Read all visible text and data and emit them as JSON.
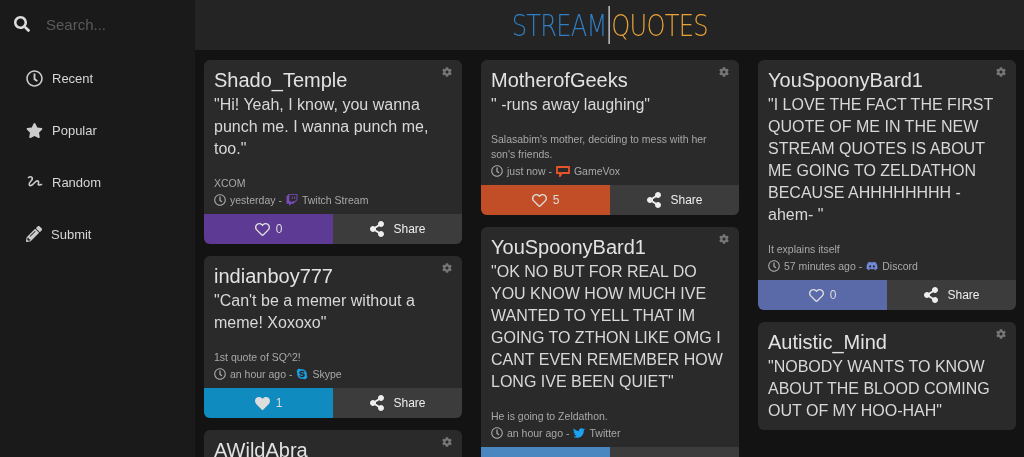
{
  "sidebar": {
    "search": {
      "placeholder": "Search..."
    },
    "items": [
      {
        "label": "Recent"
      },
      {
        "label": "Popular"
      },
      {
        "label": "Random"
      },
      {
        "label": "Submit"
      }
    ]
  },
  "header": {
    "logo": {
      "left": "STREAM",
      "right": "QUOTES"
    }
  },
  "columns": [
    {
      "cards": [
        {
          "user": "Shado_Temple",
          "quote": "\"Hi! Yeah, I know, you wanna punch me. I wanna punch me, too.\"",
          "note": "XCOM",
          "time": "yesterday -",
          "source": {
            "kind": "twitch",
            "label": "Twitch Stream"
          },
          "footer": {
            "color": "#5d3a93",
            "liked": false,
            "count": "0",
            "share": "Share"
          }
        },
        {
          "user": "indianboy777",
          "quote": "\"Can't be a memer without a meme! Xoxoxo\"",
          "note": "1st quote of SQ^2!",
          "time": "an hour ago -",
          "source": {
            "kind": "skype",
            "label": "Skype"
          },
          "footer": {
            "color": "#0f8bc0",
            "liked": true,
            "count": "1",
            "share": "Share"
          }
        },
        {
          "user": "AWildAbra"
        }
      ]
    },
    {
      "cards": [
        {
          "user": "MotherofGeeks",
          "quote": "\" -runs away laughing\"",
          "note": "Salasabim's mother, deciding to mess with her son's friends.",
          "time": "just now -",
          "source": {
            "kind": "gamevox",
            "label": "GameVox"
          },
          "footer": {
            "color": "#c14e26",
            "liked": false,
            "count": "5",
            "share": "Share"
          }
        },
        {
          "user": "YouSpoonyBard1",
          "quote": "\"OK NO BUT FOR REAL DO YOU KNOW HOW MUCH IVE WANTED TO YELL THAT IM GOING TO ZTHON LIKE OMG I CANT EVEN REMEMBER HOW LONG IVE BEEN QUIET\"",
          "note": "He is going to Zeldathon.",
          "time": "an hour ago -",
          "source": {
            "kind": "twitter",
            "label": "Twitter"
          },
          "footer": {
            "color": "#4a86c0"
          }
        }
      ]
    },
    {
      "cards": [
        {
          "user": "YouSpoonyBard1",
          "quote": "\"I LOVE THE FACT THE FIRST QUOTE OF ME IN THE NEW STREAM QUOTES IS ABOUT ME GOING TO ZELDATHON BECAUSE AHHHHHHHH - ahem- \"",
          "note": "It explains itself",
          "time": "57 minutes ago -",
          "source": {
            "kind": "discord",
            "label": "Discord"
          },
          "footer": {
            "color": "#5a6aa8",
            "liked": false,
            "count": "0",
            "share": "Share"
          }
        },
        {
          "user": "Autistic_Mind",
          "quote": "\"NOBODY WANTS TO KNOW ABOUT THE BLOOD COMING OUT OF MY HOO-HAH\""
        }
      ]
    }
  ]
}
